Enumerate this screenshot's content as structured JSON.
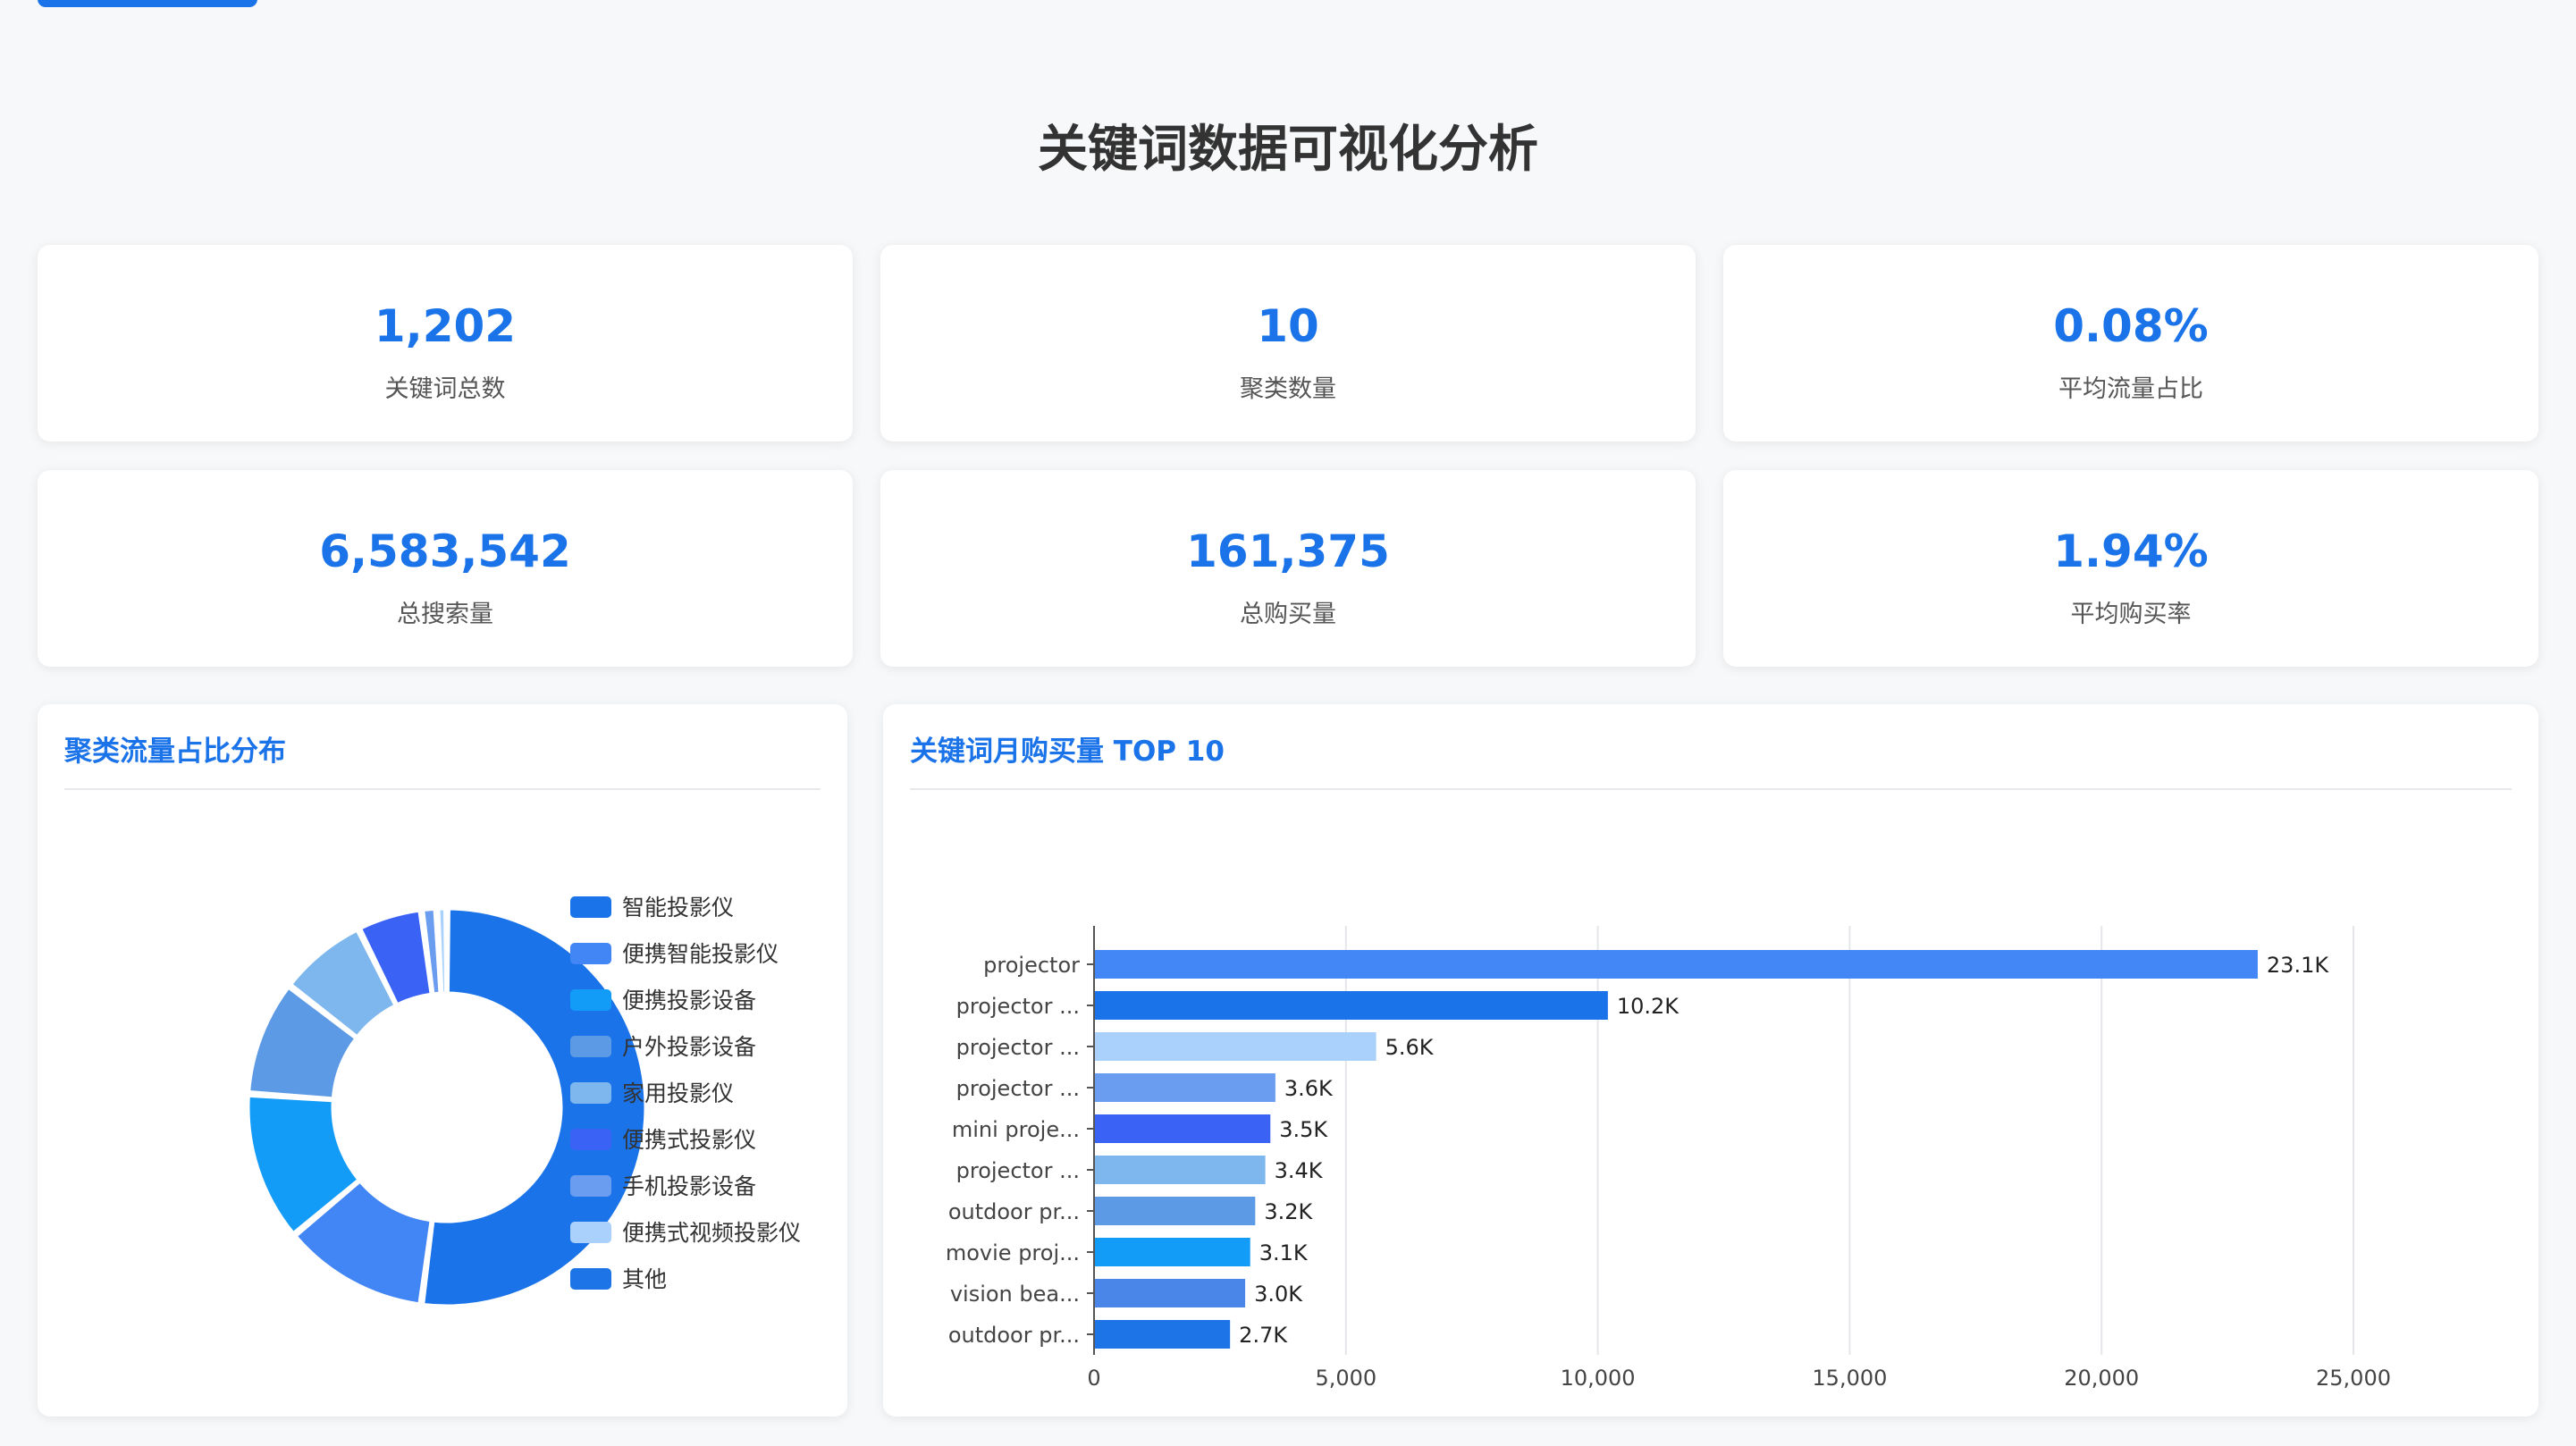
{
  "page": {
    "title": "关键词数据可视化分析"
  },
  "stats": [
    {
      "value": "1,202",
      "label": "关键词总数"
    },
    {
      "value": "10",
      "label": "聚类数量"
    },
    {
      "value": "0.08%",
      "label": "平均流量占比"
    },
    {
      "value": "6,583,542",
      "label": "总搜索量"
    },
    {
      "value": "161,375",
      "label": "总购买量"
    },
    {
      "value": "1.94%",
      "label": "平均购买率"
    }
  ],
  "panels": {
    "pie_title": "聚类流量占比分布",
    "bar_title": "关键词月购买量 TOP 10"
  },
  "colors": {
    "accent": "#1a73e8",
    "background": "#f6f8fa"
  },
  "chart_data": [
    {
      "type": "pie",
      "variant": "donut",
      "title": "聚类流量占比分布",
      "legend_position": "right",
      "categories": [
        "智能投影仪",
        "便携智能投影仪",
        "便携投影设备",
        "户外投影设备",
        "家用投影仪",
        "便携式投影仪",
        "手机投影设备",
        "便携式视频投影仪",
        "其他"
      ],
      "values": [
        50.5,
        11.5,
        11.8,
        9.1,
        7.0,
        5.1,
        1.2,
        0.8,
        0.0
      ],
      "colors": [
        "#1a73e8",
        "#4285f4",
        "#139cf7",
        "#5c9ae6",
        "#7db7ee",
        "#3a62f5",
        "#6a9cf0",
        "#a9d1fb",
        "#1c74e6"
      ]
    },
    {
      "type": "bar",
      "orientation": "horizontal",
      "title": "关键词月购买量 TOP 10",
      "categories": [
        "projector",
        "projector ...",
        "projector ...",
        "projector ...",
        "mini proje...",
        "projector ...",
        "outdoor pr...",
        "movie proj...",
        "vision bea...",
        "outdoor pr..."
      ],
      "values": [
        23100,
        10200,
        5600,
        3600,
        3500,
        3400,
        3200,
        3100,
        3000,
        2700
      ],
      "data_labels": [
        "23.1K",
        "10.2K",
        "5.6K",
        "3.6K",
        "3.5K",
        "3.4K",
        "3.2K",
        "3.1K",
        "3.0K",
        "2.7K"
      ],
      "xlim": [
        0,
        25000
      ],
      "x_ticks": [
        0,
        5000,
        10000,
        15000,
        20000,
        25000
      ],
      "x_tick_labels": [
        "0",
        "5,000",
        "10,000",
        "15,000",
        "20,000",
        "25,000"
      ],
      "grid": true,
      "colors": [
        "#4287f5",
        "#1a73e8",
        "#a9d1fb",
        "#6a9cf0",
        "#3a62f5",
        "#7db7ee",
        "#5c9ae6",
        "#139cf7",
        "#4a86e8",
        "#1c74e6"
      ]
    }
  ]
}
